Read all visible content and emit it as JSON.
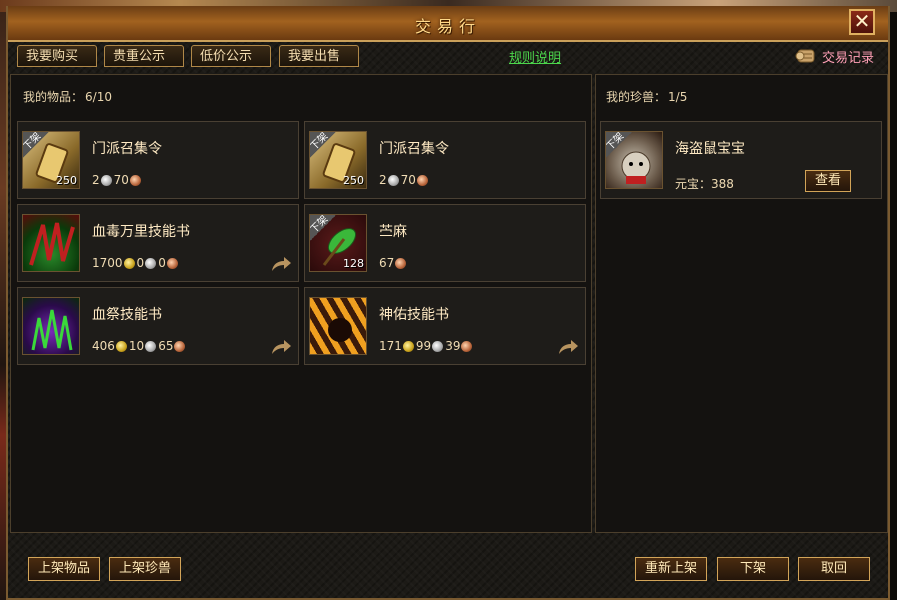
{
  "window": {
    "title": "交易行",
    "close_label": "✕"
  },
  "tabs": [
    {
      "label": "我要购买"
    },
    {
      "label": "贵重公示"
    },
    {
      "label": "低价公示"
    },
    {
      "label": "我要出售"
    }
  ],
  "rules_link": "规则说明",
  "trade_record": "交易记录",
  "items_panel": {
    "label": "我的物品：",
    "count": "6/10"
  },
  "items": [
    {
      "name": "门派召集令",
      "badge": "下架",
      "qty": "250",
      "gold": "",
      "silver": "2",
      "copper": "70",
      "has_share": false
    },
    {
      "name": "门派召集令",
      "badge": "下架",
      "qty": "250",
      "gold": "",
      "silver": "2",
      "copper": "70",
      "has_share": false
    },
    {
      "name": "血毒万里技能书",
      "badge": "",
      "qty": "",
      "gold": "1700",
      "silver": "0",
      "copper": "0",
      "has_share": true
    },
    {
      "name": "苎麻",
      "badge": "下架",
      "qty": "128",
      "gold": "",
      "silver": "",
      "copper": "67",
      "has_share": false
    },
    {
      "name": "血祭技能书",
      "badge": "",
      "qty": "",
      "gold": "406",
      "silver": "10",
      "copper": "65",
      "has_share": true
    },
    {
      "name": "神佑技能书",
      "badge": "",
      "qty": "",
      "gold": "171",
      "silver": "99",
      "copper": "39",
      "has_share": true
    }
  ],
  "pets_panel": {
    "label": "我的珍兽：",
    "count": "1/5"
  },
  "pets": [
    {
      "name": "海盗鼠宝宝",
      "badge": "下架",
      "price_label": "元宝：",
      "price": "388",
      "view_label": "查看"
    }
  ],
  "footer": {
    "list_item": "上架物品",
    "list_pet": "上架珍兽",
    "relist": "重新上架",
    "delist": "下架",
    "cancel": "取回"
  },
  "colors": {
    "accent_gold": "#d2a458",
    "title_text": "#ffd98a",
    "link_green": "#4cd64c",
    "record_pink": "#ff9fb6"
  }
}
